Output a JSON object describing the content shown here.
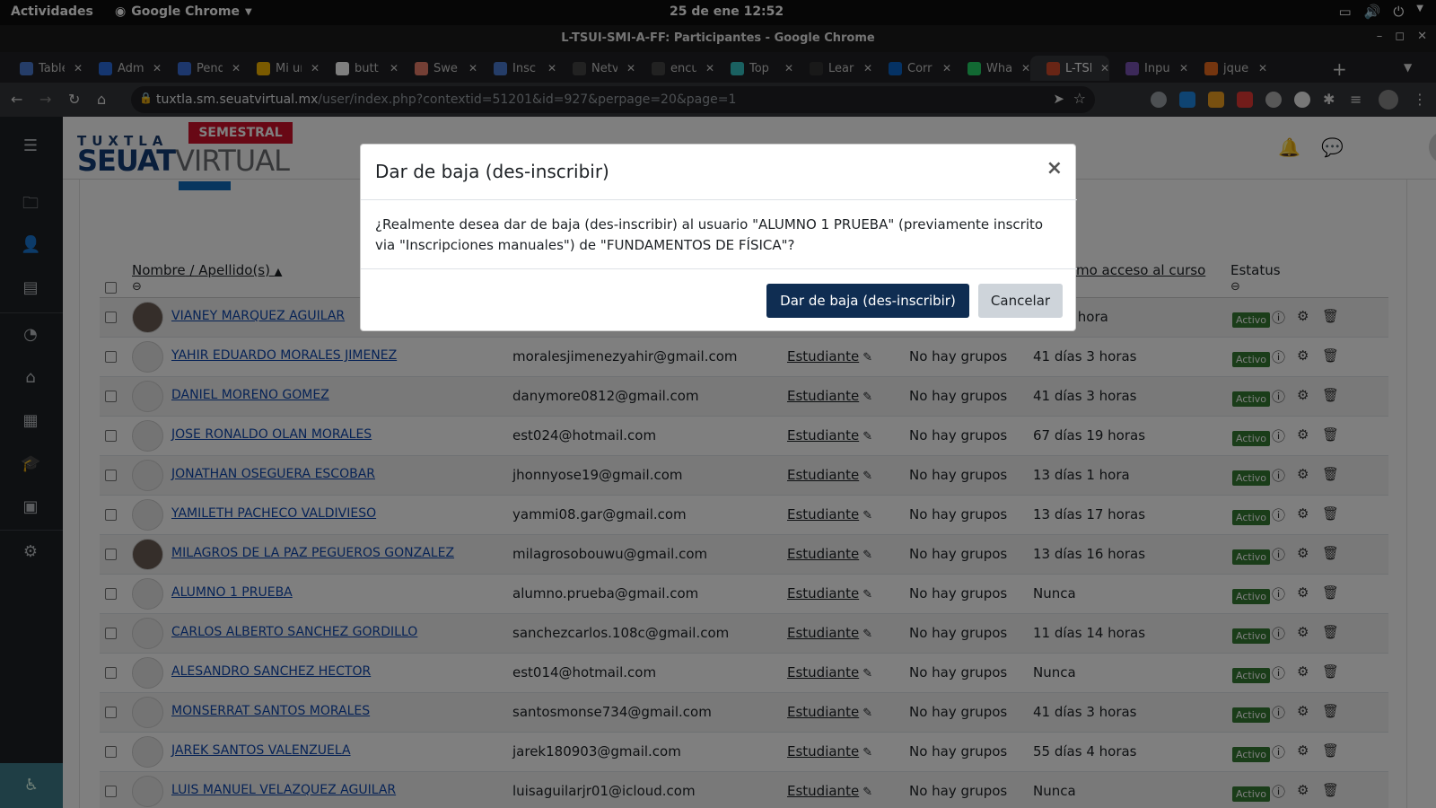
{
  "gnome": {
    "activities": "Actividades",
    "app_menu": "Google Chrome",
    "clock": "25 de ene  12:52"
  },
  "window": {
    "title": "L-TSUI-SMI-A-FF: Participantes - Google Chrome"
  },
  "tabs": [
    {
      "label": "Table",
      "color": "#4a7bd0"
    },
    {
      "label": "Adm",
      "color": "#2b6cdf"
    },
    {
      "label": "Pend",
      "color": "#3b6fd8"
    },
    {
      "label": "Mi ur",
      "color": "#f5b400"
    },
    {
      "label": "butt",
      "color": "#ffffff"
    },
    {
      "label": "Swe",
      "color": "#e87e6b"
    },
    {
      "label": "Insc",
      "color": "#4a7bd0"
    },
    {
      "label": "Netv",
      "color": "#444444"
    },
    {
      "label": "encu",
      "color": "#444444"
    },
    {
      "label": "Top",
      "color": "#35c3c3"
    },
    {
      "label": "Lear",
      "color": "#333333"
    },
    {
      "label": "Corr",
      "color": "#0a64c8"
    },
    {
      "label": "Wha",
      "color": "#25d366"
    },
    {
      "label": "L-TSI",
      "color": "#d04a2b"
    },
    {
      "label": "Inpu",
      "color": "#7952b3"
    },
    {
      "label": "jque",
      "color": "#e86a1f"
    }
  ],
  "address": {
    "domain": "tuxtla.sm.seuatvirtual.mx",
    "path": "/user/index.php?contextid=51201&id=927&perpage=20&page=1"
  },
  "brand": {
    "semestral": "SEMESTRAL",
    "tuxtla": "TUXTLA",
    "seuat": "SEUAT",
    "virtual": "VIRTUAL"
  },
  "table": {
    "col_name": "Nombre",
    "col_sep": "/",
    "col_surname": "Apellido(s)",
    "col_last_access": "mo acceso al curso",
    "col_status": "Estatus",
    "rows": [
      {
        "name": "VIANEY MARQUEZ AGUILAR",
        "email": "",
        "role": "",
        "groups": "",
        "last": "días 1 hora",
        "status": "Activo"
      },
      {
        "name": "YAHIR EDUARDO MORALES JIMENEZ",
        "email": "moralesjimenezyahir@gmail.com",
        "role": "Estudiante",
        "groups": "No hay grupos",
        "last": "41 días 3 horas",
        "status": "Activo"
      },
      {
        "name": "DANIEL MORENO GOMEZ",
        "email": "danymore0812@gmail.com",
        "role": "Estudiante",
        "groups": "No hay grupos",
        "last": "41 días 3 horas",
        "status": "Activo"
      },
      {
        "name": "JOSE RONALDO OLAN MORALES",
        "email": "est024@hotmail.com",
        "role": "Estudiante",
        "groups": "No hay grupos",
        "last": "67 días 19 horas",
        "status": "Activo"
      },
      {
        "name": "JONATHAN OSEGUERA ESCOBAR",
        "email": "jhonnyose19@gmail.com",
        "role": "Estudiante",
        "groups": "No hay grupos",
        "last": "13 días 1 hora",
        "status": "Activo"
      },
      {
        "name": "YAMILETH PACHECO VALDIVIESO",
        "email": "yammi08.gar@gmail.com",
        "role": "Estudiante",
        "groups": "No hay grupos",
        "last": "13 días 17 horas",
        "status": "Activo"
      },
      {
        "name": "MILAGROS DE LA PAZ PEGUEROS GONZALEZ",
        "email": "milagrosobouwu@gmail.com",
        "role": "Estudiante",
        "groups": "No hay grupos",
        "last": "13 días 16 horas",
        "status": "Activo"
      },
      {
        "name": "ALUMNO 1 PRUEBA",
        "email": "alumno.prueba@gmail.com",
        "role": "Estudiante",
        "groups": "No hay grupos",
        "last": "Nunca",
        "status": "Activo"
      },
      {
        "name": "CARLOS ALBERTO SANCHEZ GORDILLO",
        "email": "sanchezcarlos.108c@gmail.com",
        "role": "Estudiante",
        "groups": "No hay grupos",
        "last": "11 días 14 horas",
        "status": "Activo"
      },
      {
        "name": "ALESANDRO SANCHEZ HECTOR",
        "email": "est014@hotmail.com",
        "role": "Estudiante",
        "groups": "No hay grupos",
        "last": "Nunca",
        "status": "Activo"
      },
      {
        "name": "MONSERRAT SANTOS MORALES",
        "email": "santosmonse734@gmail.com",
        "role": "Estudiante",
        "groups": "No hay grupos",
        "last": "41 días 3 horas",
        "status": "Activo"
      },
      {
        "name": "JAREK SANTOS VALENZUELA",
        "email": "jarek180903@gmail.com",
        "role": "Estudiante",
        "groups": "No hay grupos",
        "last": "55 días 4 horas",
        "status": "Activo"
      },
      {
        "name": "LUIS MANUEL VELAZQUEZ AGUILAR",
        "email": "luisaguilarjr01@icloud.com",
        "role": "Estudiante",
        "groups": "No hay grupos",
        "last": "Nunca",
        "status": "Activo"
      }
    ]
  },
  "modal": {
    "title": "Dar de baja (des-inscribir)",
    "body": "¿Realmente desea dar de baja (des-inscribir) al usuario \"ALUMNO 1 PRUEBA\" (previamente inscrito via \"Inscripciones manuales\") de \"FUNDAMENTOS DE FÍSICA\"?",
    "confirm_label": "Dar de baja (des-inscribir)",
    "cancel_label": "Cancelar"
  }
}
